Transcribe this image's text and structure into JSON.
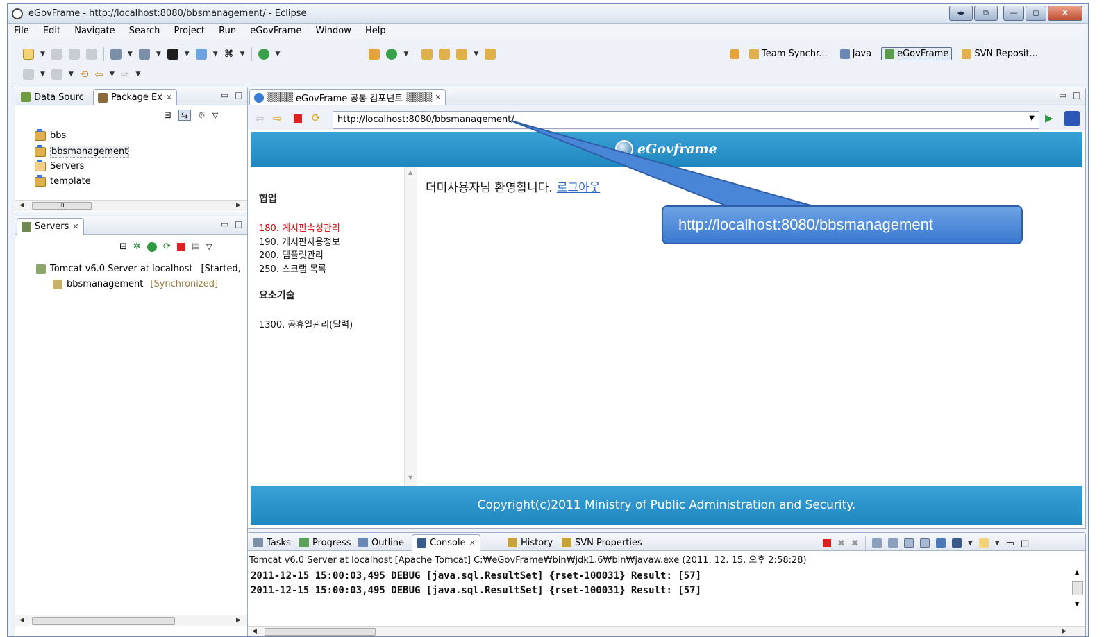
{
  "window": {
    "title": "eGovFrame - http://localhost:8080/bbsmanagement/ - Eclipse",
    "controls": [
      "◂▸",
      "⧉",
      "—",
      "◻",
      "X"
    ]
  },
  "menu": [
    "File",
    "Edit",
    "Navigate",
    "Search",
    "Project",
    "Run",
    "eGovFrame",
    "Window",
    "Help"
  ],
  "perspectives": [
    {
      "label": "Team Synchr...",
      "icon": "team-sync-icon"
    },
    {
      "label": "Java",
      "icon": "java-icon"
    },
    {
      "label": "eGovFrame",
      "icon": "egov-icon",
      "active": true
    },
    {
      "label": "SVN Reposit...",
      "icon": "svn-icon"
    }
  ],
  "left_top_panel": {
    "tabs": [
      {
        "label": "Data Sourc",
        "icon": "data-source-icon"
      },
      {
        "label": "Package Ex",
        "icon": "package-explorer-icon",
        "active": true
      }
    ],
    "tree": [
      {
        "label": "bbs",
        "icon": "project-icon"
      },
      {
        "label": "bbsmanagement",
        "icon": "project-icon",
        "selected": true
      },
      {
        "label": "Servers",
        "icon": "folder-icon"
      },
      {
        "label": "template",
        "icon": "project-icon"
      }
    ],
    "scroll_glyph": "III"
  },
  "servers_panel": {
    "tab_label": "Servers",
    "server": "Tomcat v6.0 Server at localhost",
    "server_state": "[Started,",
    "module": "bbsmanagement",
    "module_state": "[Synchronized]"
  },
  "browser": {
    "tab_label": "eGovFrame 공통 컴포넌트",
    "url": "http://localhost:8080/bbsmanagement/",
    "logo_text": "eGovframe",
    "sidebar": {
      "heading1": "협업",
      "links": [
        {
          "label": "180. 게시판속성관리",
          "active": true
        },
        {
          "label": "190. 게시판사용정보"
        },
        {
          "label": "200. 템플릿관리"
        },
        {
          "label": "250. 스크랩 목록"
        }
      ],
      "heading2": "요소기술",
      "links2": [
        {
          "label": "1300. 공휴일관리(달력)"
        }
      ]
    },
    "welcome_text": "더미사용자님 환영합니다.",
    "logout_link": "로그아웃",
    "footer": "Copyright(c)2011 Ministry of Public Administration and Security."
  },
  "callout": {
    "text": "http://localhost:8080/bbsmanagement"
  },
  "bottom_panel": {
    "tabs": [
      {
        "label": "Tasks",
        "icon": "tasks-icon"
      },
      {
        "label": "Progress",
        "icon": "progress-icon"
      },
      {
        "label": "Outline",
        "icon": "outline-icon"
      },
      {
        "label": "Console",
        "icon": "console-icon",
        "active": true
      },
      {
        "label": "History",
        "icon": "history-icon"
      },
      {
        "label": "SVN Properties",
        "icon": "svn-properties-icon"
      }
    ],
    "console_info": "Tomcat v6.0 Server at localhost [Apache Tomcat] C:₩eGovFrame₩bin₩jdk1.6₩bin₩javaw.exe (2011. 12. 15. 오후 2:58:28)",
    "console_lines": [
      "2011-12-15 15:00:03,495 DEBUG [java.sql.ResultSet] {rset-100031} Result: [57]",
      "2011-12-15 15:00:03,495 DEBUG [java.sql.ResultSet] {rset-100031} Result: [57]"
    ]
  },
  "colors": {
    "egov_blue": "#2a91c9",
    "callout_blue": "#4a86d8",
    "active_link_red": "#e30000",
    "link_blue": "#2a66c9"
  }
}
